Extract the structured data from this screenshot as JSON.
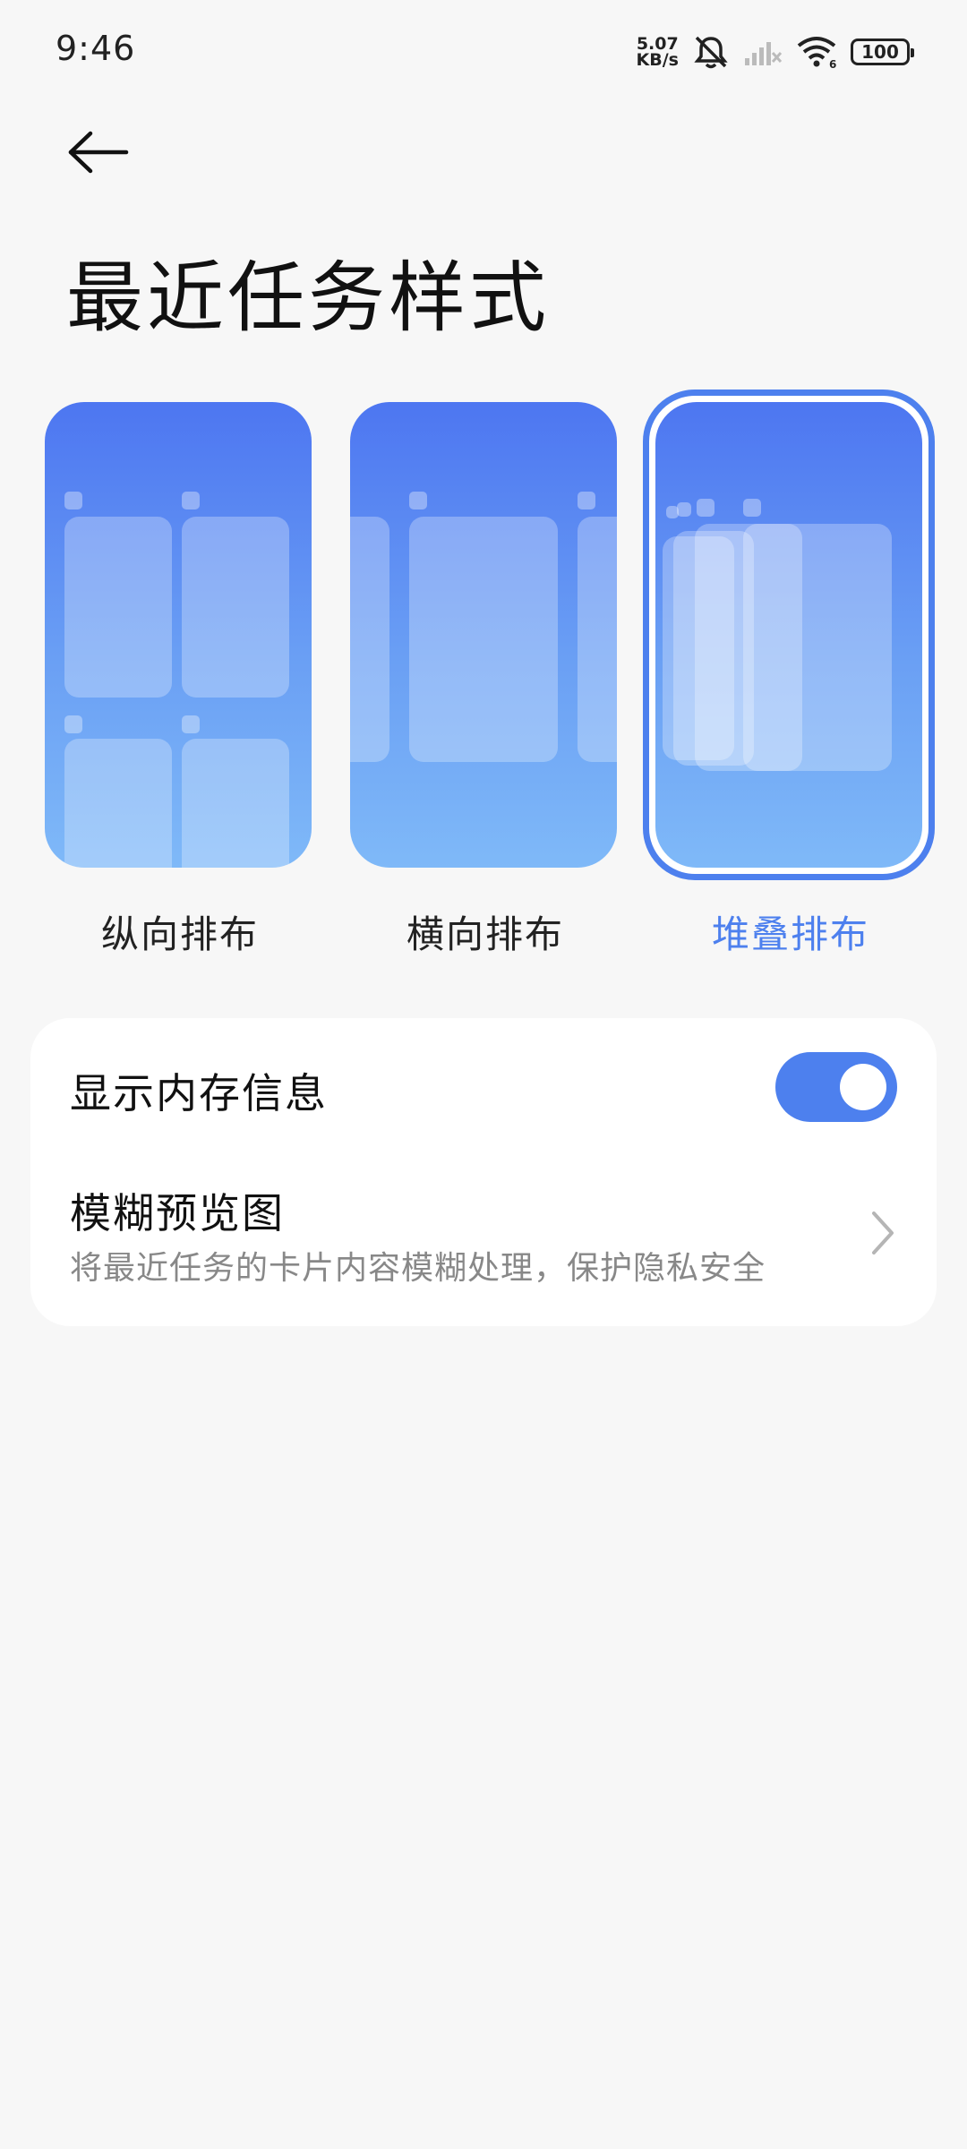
{
  "status_bar": {
    "time": "9:46",
    "net_speed_value": "5.07",
    "net_speed_unit": "KB/s",
    "battery": "100",
    "icons": [
      "mute-bell-icon",
      "signal-icon",
      "wifi-icon",
      "battery-icon"
    ]
  },
  "header": {
    "title": "最近任务样式"
  },
  "styles": {
    "options": [
      {
        "label": "纵向排布",
        "selected": false
      },
      {
        "label": "横向排布",
        "selected": false
      },
      {
        "label": "堆叠排布",
        "selected": true
      }
    ]
  },
  "settings": {
    "memory_label": "显示内存信息",
    "memory_toggle_on": true,
    "blur_title": "模糊预览图",
    "blur_desc": "将最近任务的卡片内容模糊处理，保护隐私安全"
  },
  "colors": {
    "accent": "#4d80ee",
    "background": "#f7f7f7"
  }
}
